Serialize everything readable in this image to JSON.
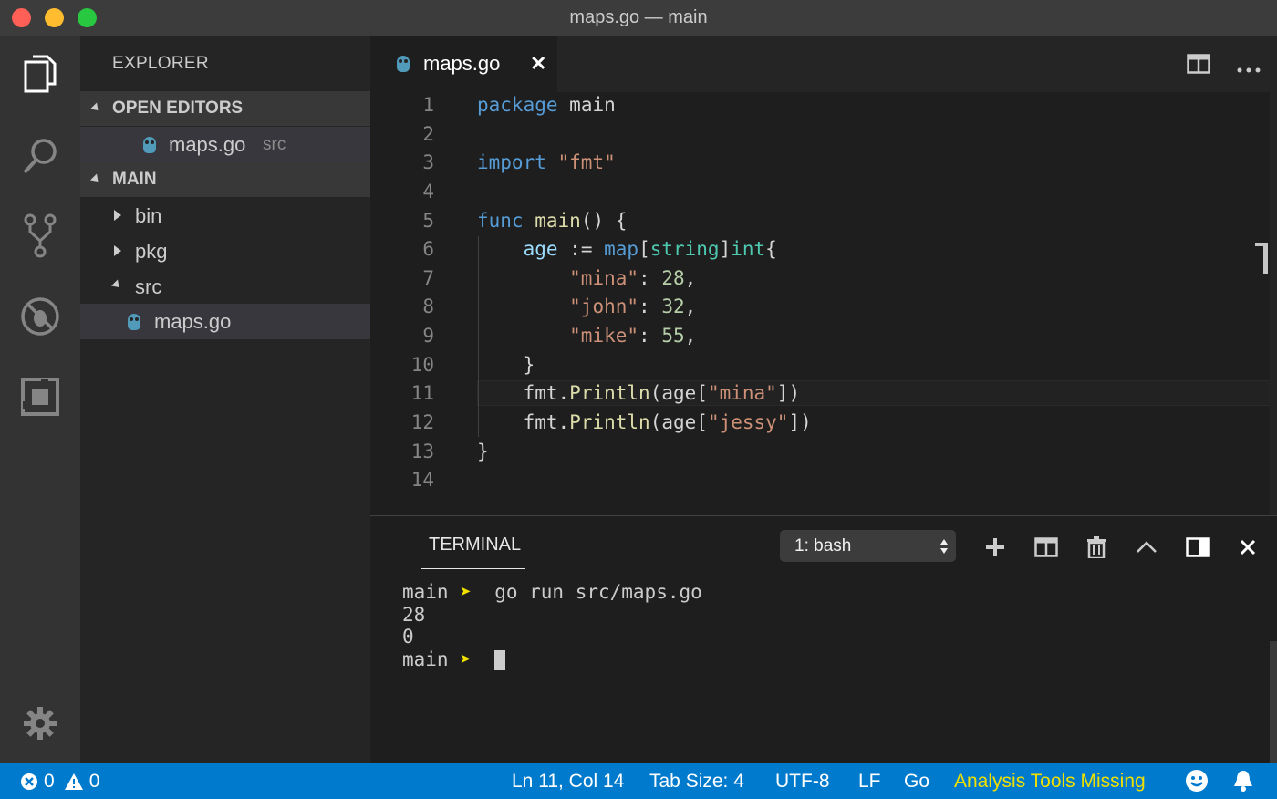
{
  "window": {
    "title": "maps.go — main"
  },
  "explorer": {
    "title": "EXPLORER",
    "open_editors": {
      "label": "OPEN EDITORS",
      "items": [
        {
          "name": "maps.go",
          "path": "src"
        }
      ]
    },
    "folder": {
      "label": "MAIN",
      "items": [
        "bin",
        "pkg",
        "src",
        "maps.go"
      ]
    }
  },
  "editor": {
    "tab": {
      "label": "maps.go",
      "close": "✕"
    },
    "line_numbers": [
      "1",
      "2",
      "3",
      "4",
      "5",
      "6",
      "7",
      "8",
      "9",
      "10",
      "11",
      "12",
      "13",
      "14"
    ],
    "current_line": "11"
  },
  "terminal": {
    "title": "TERMINAL",
    "shell_select": "1: bash",
    "lines": [
      {
        "prompt": "main",
        "arrow": "➤",
        "text": "go run src/maps.go"
      },
      {
        "text": "28"
      },
      {
        "text": "0"
      },
      {
        "prompt": "main",
        "arrow": "➤",
        "text": ""
      }
    ]
  },
  "statusbar": {
    "errors": "0",
    "warnings": "0",
    "position": "Ln 11, Col 14",
    "tab_size": "Tab Size: 4",
    "encoding": "UTF-8",
    "eol": "LF",
    "language": "Go",
    "analysis": "Analysis Tools Missing"
  },
  "colors": {
    "accent": "#007acc",
    "keyword": "#569cd6",
    "string": "#ce9178",
    "number": "#b5cea8",
    "function": "#dcdcaa",
    "variable": "#9cdcfe",
    "type": "#4ec9b0",
    "warning_text": "#f0e000",
    "go_icon": "#519aba"
  },
  "icons": [
    "files-icon",
    "search-icon",
    "source-control-icon",
    "debug-icon",
    "extensions-icon",
    "gear-icon",
    "split-editor-icon",
    "more-icon",
    "plus-icon",
    "trash-icon",
    "chevron-up-icon",
    "maximize-icon",
    "close-icon",
    "error-icon",
    "warning-icon",
    "smiley-icon",
    "bell-icon"
  ]
}
